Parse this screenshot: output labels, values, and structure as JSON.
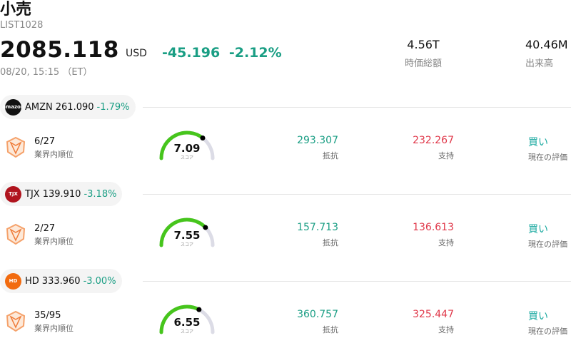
{
  "header": {
    "title": "小売",
    "code": "LIST1028",
    "price": "2085.118",
    "currency": "USD",
    "change_abs": "-45.196",
    "change_pct": "-2.12%",
    "timestamp": "08/20, 15:15 （ET）",
    "market_cap_value": "4.56T",
    "market_cap_label": "時価総額",
    "volume_value": "40.46M",
    "volume_label": "出来高"
  },
  "colors": {
    "positive": "#1a9e84",
    "negative": "#e0384a",
    "gauge_fill": "#46c51c",
    "gauge_track": "#dcdce6",
    "rating": "#1aa9a0"
  },
  "stocks": [
    {
      "symbol": "AMZN",
      "price": "261.090",
      "change": "-1.79%",
      "logo_icon": "amazon-logo-icon",
      "logo_text": "amazon",
      "logo_color": "#111111",
      "rank": "6/27",
      "rank_label": "業界内順位",
      "score": "7.09",
      "score_value": 7.09,
      "score_label": "スコア",
      "resistance": "293.307",
      "resistance_label": "抵抗",
      "support": "232.267",
      "support_label": "支持",
      "rating": "買い",
      "rating_label": "現在の評価"
    },
    {
      "symbol": "TJX",
      "price": "139.910",
      "change": "-3.18%",
      "logo_icon": "tjx-logo-icon",
      "logo_text": "TJX",
      "logo_color": "#b0141e",
      "rank": "2/27",
      "rank_label": "業界内順位",
      "score": "7.55",
      "score_value": 7.55,
      "score_label": "スコア",
      "resistance": "157.713",
      "resistance_label": "抵抗",
      "support": "136.613",
      "support_label": "支持",
      "rating": "買い",
      "rating_label": "現在の評価"
    },
    {
      "symbol": "HD",
      "price": "333.960",
      "change": "-3.00%",
      "logo_icon": "home-depot-logo-icon",
      "logo_text": "HD",
      "logo_color": "#f26b0f",
      "rank": "35/95",
      "rank_label": "業界内順位",
      "score": "6.55",
      "score_value": 6.55,
      "score_label": "スコア",
      "resistance": "360.757",
      "resistance_label": "抵抗",
      "support": "325.447",
      "support_label": "支持",
      "rating": "買い",
      "rating_label": "現在の評価"
    }
  ]
}
